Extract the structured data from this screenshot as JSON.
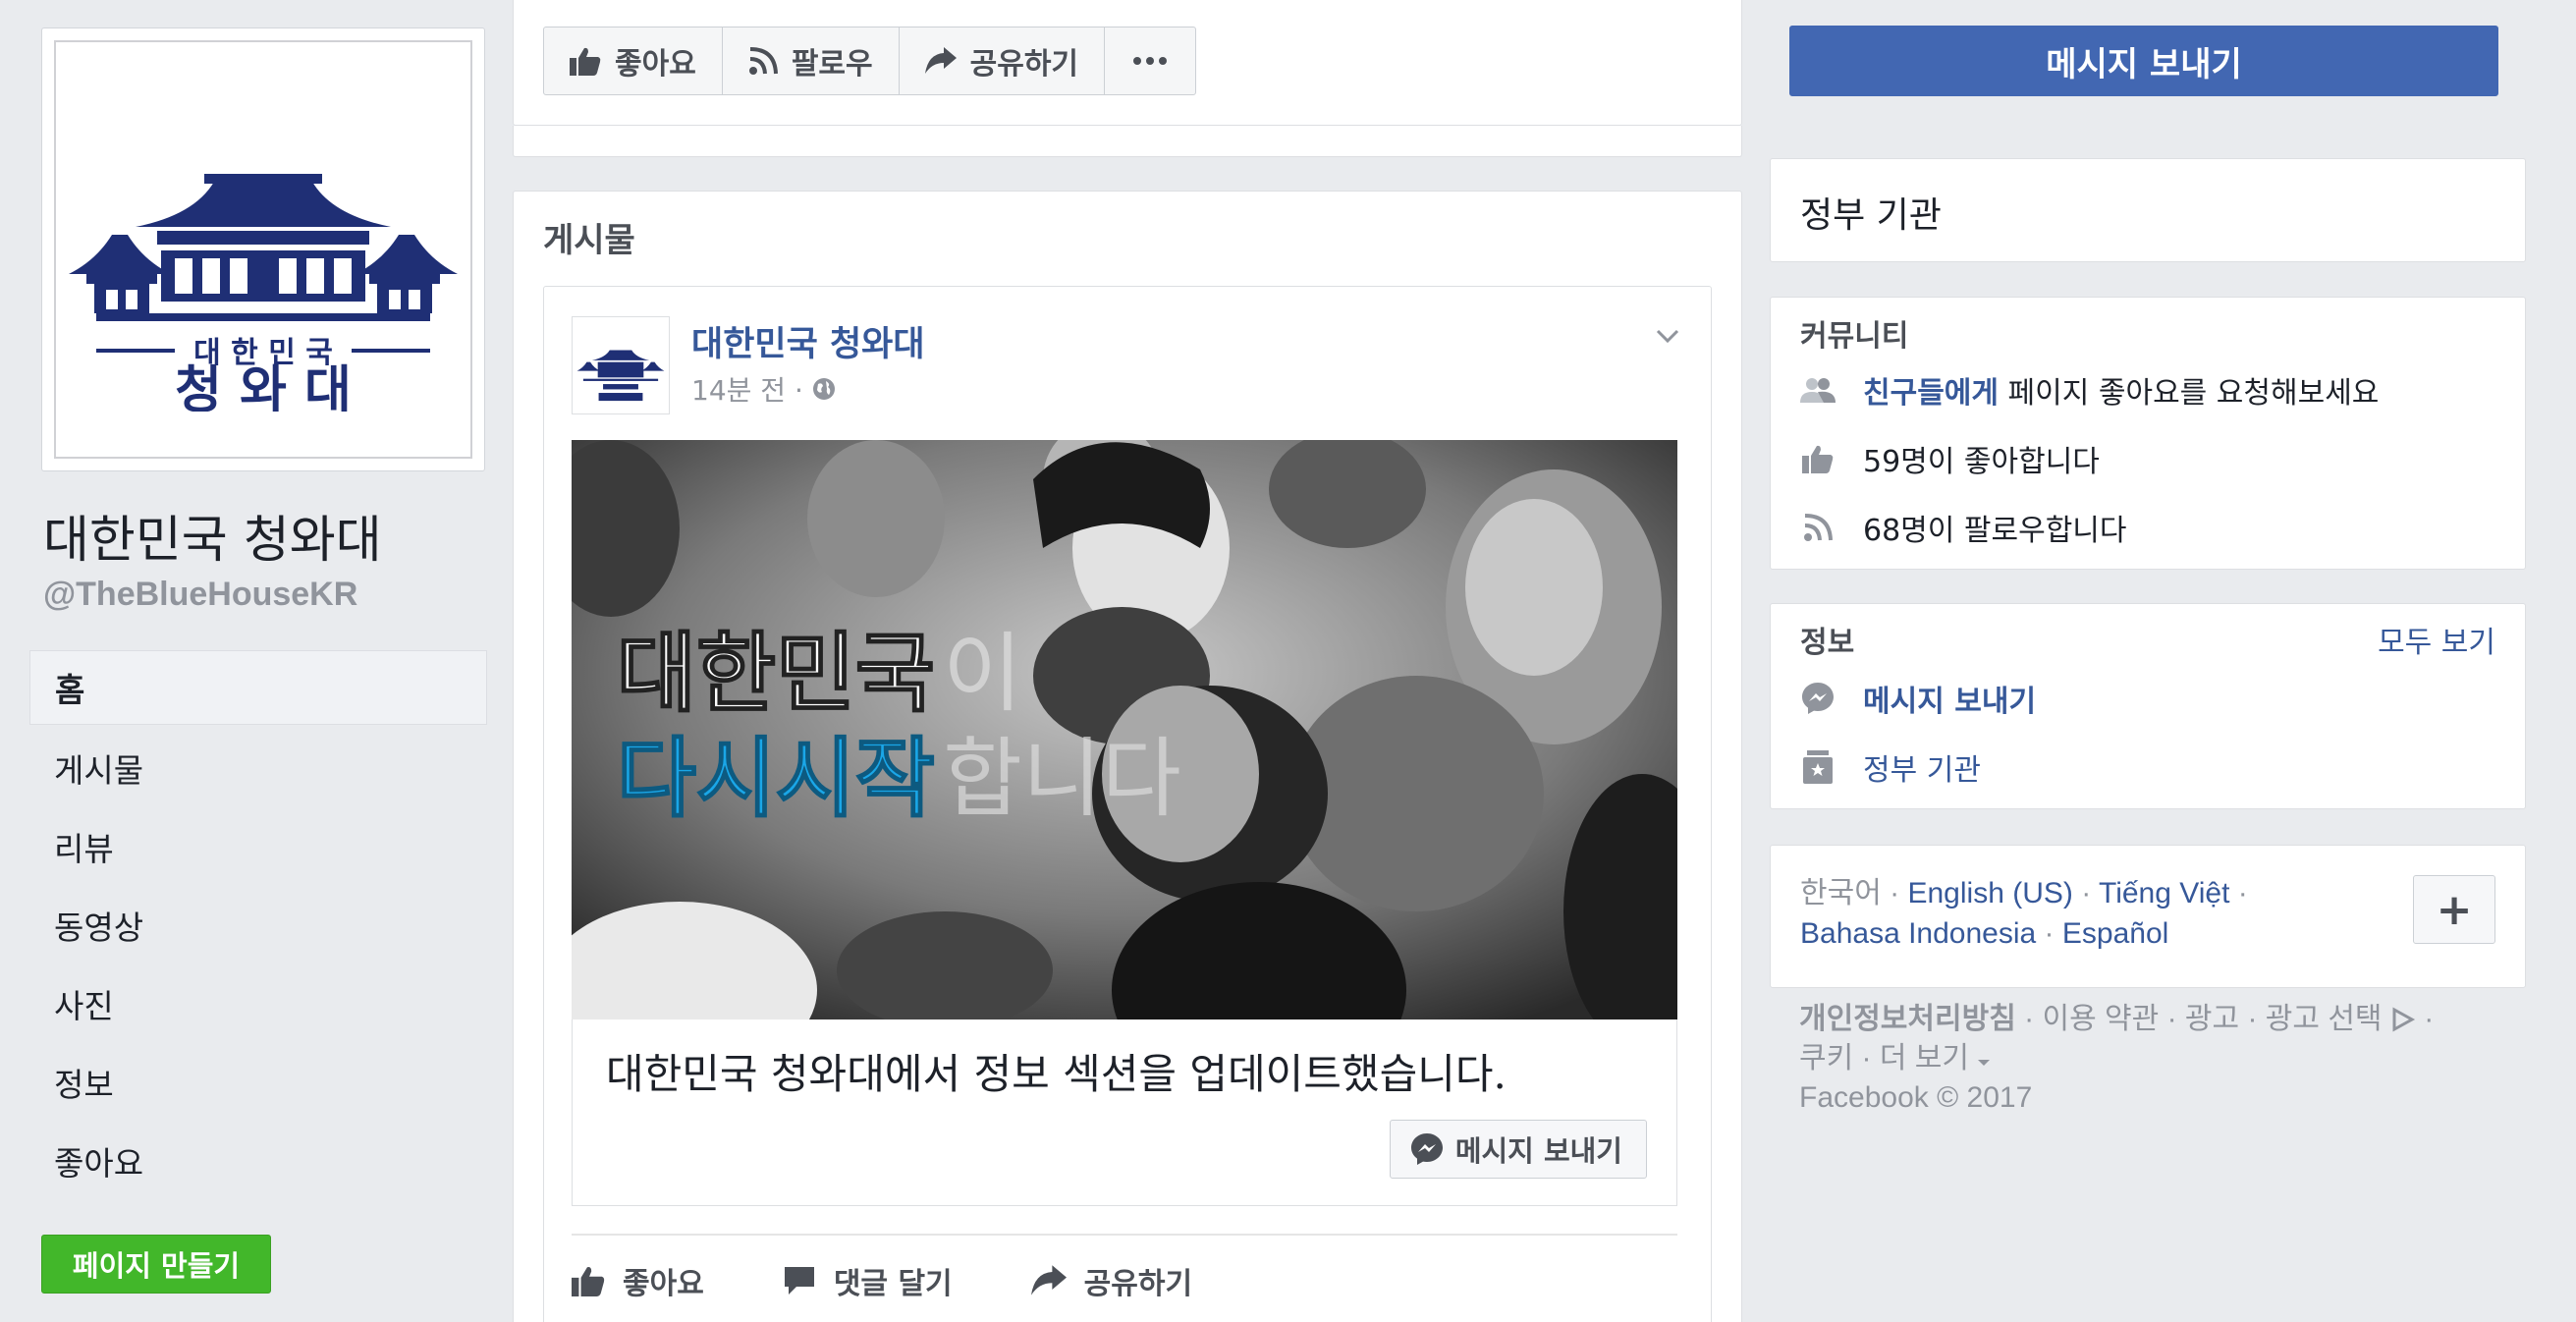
{
  "page": {
    "name": "대한민국 청와대",
    "handle": "@TheBlueHouseKR",
    "logo": {
      "line1": "대 한 민 국",
      "line2": "청 와 대"
    }
  },
  "nav": {
    "items": [
      {
        "label": "홈",
        "active": true
      },
      {
        "label": "게시물"
      },
      {
        "label": "리뷰"
      },
      {
        "label": "동영상"
      },
      {
        "label": "사진"
      },
      {
        "label": "정보"
      },
      {
        "label": "좋아요"
      }
    ],
    "create_page": "페이지 만들기"
  },
  "actions": {
    "like": "좋아요",
    "follow": "팔로우",
    "share": "공유하기",
    "more_icon": "ellipsis-icon"
  },
  "send_message": "메시지 보내기",
  "posts": {
    "title": "게시물",
    "post": {
      "author": "대한민국 청와대",
      "time": "14분 전 ·",
      "image_text": {
        "line1_a": "대한민국",
        "line1_b": "이",
        "line2_a": "다시시작",
        "line2_b": "합니다"
      },
      "caption": "대한민국 청와대에서 정보 섹션을 업데이트했습니다.",
      "message_button": "메시지 보내기",
      "actions": {
        "like": "좋아요",
        "comment": "댓글 달기",
        "share": "공유하기"
      }
    }
  },
  "sidebar": {
    "category": "정부 기관",
    "community": {
      "heading": "커뮤니티",
      "invite_link": "친구들에게",
      "invite_rest": " 페이지 좋아요를 요청해보세요",
      "likes": "59명이 좋아합니다",
      "follows": "68명이 팔로우합니다"
    },
    "info": {
      "heading": "정보",
      "see_all": "모두 보기",
      "message": "메시지 보내기",
      "category": "정부 기관"
    },
    "languages": {
      "current": "한국어",
      "options": [
        "English (US)",
        "Tiếng Việt",
        "Bahasa Indonesia",
        "Español"
      ],
      "more": "+"
    },
    "footer": {
      "privacy": "개인정보처리방침",
      "terms": "이용 약관",
      "ads": "광고",
      "ad_choices": "광고 선택",
      "cookies": "쿠키",
      "more": "더 보기",
      "copyright": "Facebook © 2017"
    }
  },
  "colors": {
    "brand_blue": "#4267b2",
    "link_blue": "#365899",
    "green": "#42b72a",
    "background": "#e9ebee",
    "logo_navy": "#1f2f75"
  }
}
